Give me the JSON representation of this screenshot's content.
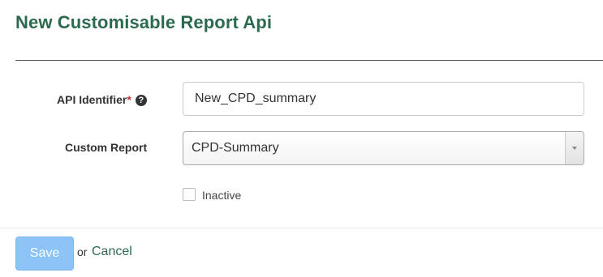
{
  "page": {
    "title": "New Customisable Report Api"
  },
  "form": {
    "api_identifier": {
      "label": "API Identifier",
      "required_mark": "*",
      "help_icon": "question-circle-icon",
      "help_glyph": "?",
      "value": "New_CPD_summary"
    },
    "custom_report": {
      "label": "Custom Report",
      "selected_value": "CPD-Summary"
    },
    "inactive": {
      "label": "Inactive",
      "checked": false
    }
  },
  "actions": {
    "save_label": "Save",
    "or_text": "or",
    "cancel_label": "Cancel"
  },
  "colors": {
    "title": "#2b6a4f",
    "save_button": "#8cc4f7",
    "required": "#c9302c"
  }
}
